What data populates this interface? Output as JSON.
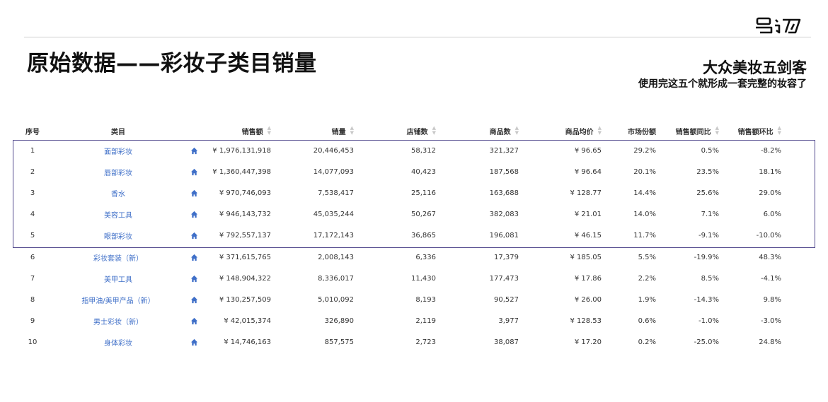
{
  "header": {
    "title": "原始数据——彩妆子类目销量",
    "subtitle": "大众美妆五剑客",
    "caption": "使用完这五个就形成一套完整的妆容了",
    "logo_icon": "brand-logo-icon"
  },
  "table": {
    "columns": {
      "idx": "序号",
      "category": "类目",
      "sales": "销售额",
      "volume": "销量",
      "shops": "店铺数",
      "products": "商品数",
      "avg_price": "商品均价",
      "share": "市场份额",
      "yoy": "销售额同比",
      "mom": "销售额环比"
    },
    "link_color": "#3f6fc8",
    "highlight_color": "#534a8e",
    "rows": [
      {
        "idx": "1",
        "category": "面部彩妆",
        "sales": "¥ 1,976,131,918",
        "volume": "20,446,453",
        "shops": "58,312",
        "products": "321,327",
        "avg_price": "¥ 96.65",
        "share": "29.2%",
        "yoy": "0.5%",
        "mom": "-8.2%"
      },
      {
        "idx": "2",
        "category": "唇部彩妆",
        "sales": "¥ 1,360,447,398",
        "volume": "14,077,093",
        "shops": "40,423",
        "products": "187,568",
        "avg_price": "¥ 96.64",
        "share": "20.1%",
        "yoy": "23.5%",
        "mom": "18.1%"
      },
      {
        "idx": "3",
        "category": "香水",
        "sales": "¥ 970,746,093",
        "volume": "7,538,417",
        "shops": "25,116",
        "products": "163,688",
        "avg_price": "¥ 128.77",
        "share": "14.4%",
        "yoy": "25.6%",
        "mom": "29.0%"
      },
      {
        "idx": "4",
        "category": "美容工具",
        "sales": "¥ 946,143,732",
        "volume": "45,035,244",
        "shops": "50,267",
        "products": "382,083",
        "avg_price": "¥ 21.01",
        "share": "14.0%",
        "yoy": "7.1%",
        "mom": "6.0%"
      },
      {
        "idx": "5",
        "category": "眼部彩妆",
        "sales": "¥ 792,557,137",
        "volume": "17,172,143",
        "shops": "36,865",
        "products": "196,081",
        "avg_price": "¥ 46.15",
        "share": "11.7%",
        "yoy": "-9.1%",
        "mom": "-10.0%"
      },
      {
        "idx": "6",
        "category": "彩妆套装（新）",
        "sales": "¥ 371,615,765",
        "volume": "2,008,143",
        "shops": "6,336",
        "products": "17,379",
        "avg_price": "¥ 185.05",
        "share": "5.5%",
        "yoy": "-19.9%",
        "mom": "48.3%"
      },
      {
        "idx": "7",
        "category": "美甲工具",
        "sales": "¥ 148,904,322",
        "volume": "8,336,017",
        "shops": "11,430",
        "products": "177,473",
        "avg_price": "¥ 17.86",
        "share": "2.2%",
        "yoy": "8.5%",
        "mom": "-4.1%"
      },
      {
        "idx": "8",
        "category": "指甲油/美甲产品（新）",
        "sales": "¥ 130,257,509",
        "volume": "5,010,092",
        "shops": "8,193",
        "products": "90,527",
        "avg_price": "¥ 26.00",
        "share": "1.9%",
        "yoy": "-14.3%",
        "mom": "9.8%"
      },
      {
        "idx": "9",
        "category": "男士彩妆（新）",
        "sales": "¥ 42,015,374",
        "volume": "326,890",
        "shops": "2,119",
        "products": "3,977",
        "avg_price": "¥ 128.53",
        "share": "0.6%",
        "yoy": "-1.0%",
        "mom": "-3.0%"
      },
      {
        "idx": "10",
        "category": "身体彩妆",
        "sales": "¥ 14,746,163",
        "volume": "857,575",
        "shops": "2,723",
        "products": "38,087",
        "avg_price": "¥ 17.20",
        "share": "0.2%",
        "yoy": "-25.0%",
        "mom": "24.8%"
      }
    ]
  }
}
